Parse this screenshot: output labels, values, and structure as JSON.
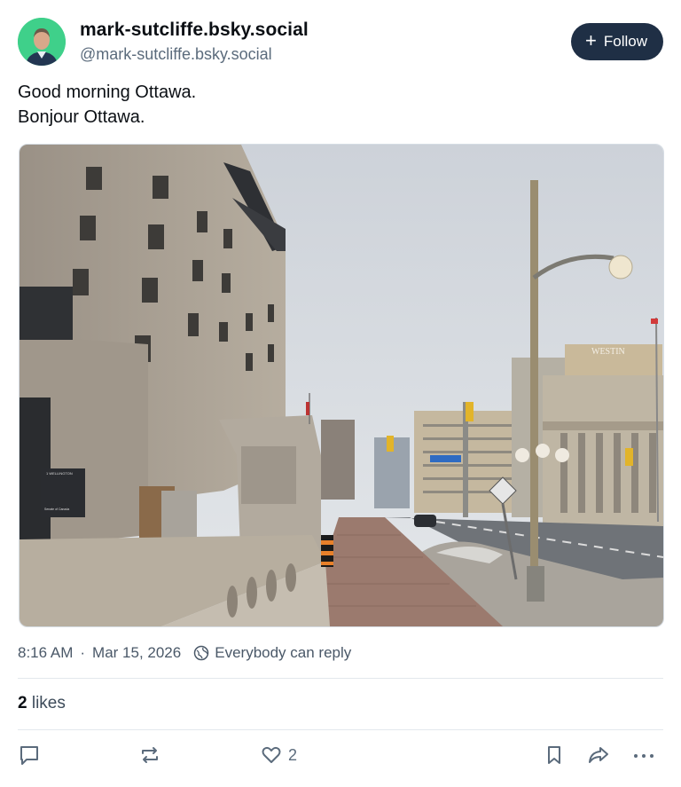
{
  "author": {
    "display_name": "mark-sutcliffe.bsky.social",
    "handle": "@mark-sutcliffe.bsky.social",
    "avatar_icon": "avatar-photo",
    "avatar_bg": "#3fd08a"
  },
  "follow_button": {
    "label": "Follow",
    "icon": "plus-icon"
  },
  "post": {
    "line1": "Good morning Ottawa.",
    "line2": "Bonjour Ottawa.",
    "image_signs": {
      "hotel": "WESTIN",
      "plaque": "1 WELLINGTON",
      "plaque_sub": "Senate of Canada"
    }
  },
  "meta": {
    "time": "8:16 AM",
    "separator": "·",
    "date": "Mar 15, 2026",
    "reply_setting": "Everybody can reply"
  },
  "likes": {
    "count": "2",
    "label": "likes"
  },
  "actions": {
    "reply_icon": "comment-icon",
    "repost_icon": "repost-icon",
    "like_icon": "heart-icon",
    "like_count": "2",
    "bookmark_icon": "bookmark-icon",
    "share_icon": "share-icon",
    "more_icon": "more-icon"
  },
  "colors": {
    "follow_bg": "#1f2f45",
    "muted_text": "#5b6b7c"
  }
}
